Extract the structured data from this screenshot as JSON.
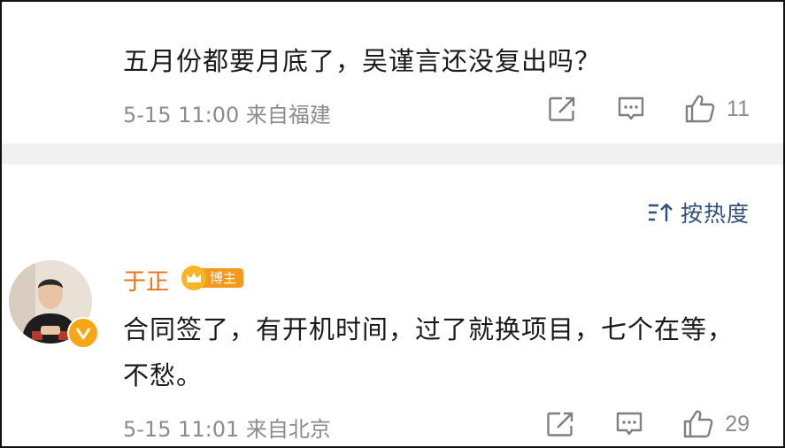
{
  "comments": [
    {
      "text": "五月份都要月底了，吴谨言还没复出吗？",
      "date": "5-15",
      "time": "11:00",
      "location": "来自福建",
      "likes": "11"
    },
    {
      "username": "于正",
      "badge": "博主",
      "text": "合同签了，有开机时间，过了就换项目，七个在等，不愁。",
      "date": "5-15",
      "time": "11:01",
      "location": "来自北京",
      "likes": "29"
    }
  ],
  "sort": {
    "label": "按热度",
    "icon": "sort-icon"
  },
  "icons": {
    "share": "share-icon",
    "comment": "comment-icon",
    "like": "thumbs-up-icon",
    "verified": "verified-v-icon",
    "crown": "crown-icon"
  },
  "colors": {
    "username": "#e8731b",
    "sort_link": "#33507a",
    "meta_text": "#8c8c8c",
    "badge_bg": "#f19a1e",
    "verified_badge": "#f8a516",
    "separator": "#f1f1f1"
  }
}
